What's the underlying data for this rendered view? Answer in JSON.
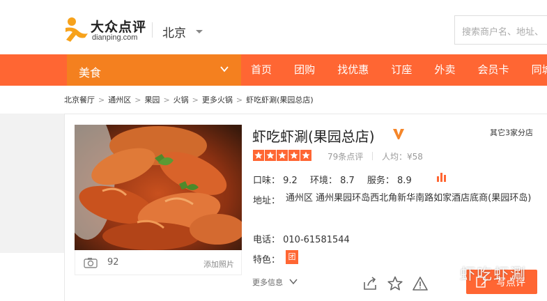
{
  "header": {
    "logo_cn": "大众点评",
    "logo_en": "dianping.com",
    "city": "北京",
    "search_placeholder": "搜索商户名、地址、"
  },
  "nav": {
    "category": "美食",
    "items": [
      "首页",
      "团购",
      "找优惠",
      "订座",
      "外卖",
      "会员卡",
      "同城"
    ]
  },
  "breadcrumb": [
    "北京餐厅",
    "通州区",
    "果园",
    "火锅",
    "更多火锅",
    "虾吃虾涮(果园总店)"
  ],
  "shop": {
    "name": "虾吃虾涮(果园总店)",
    "branches": "其它3家分店",
    "stars": 5,
    "review_count": "79条点评",
    "per_capita": "人均：¥58",
    "scores": {
      "taste": "口味： 9.2",
      "env": "环境： 8.7",
      "service": "服务： 8.9"
    },
    "address_label": "地址：",
    "address": "通州区 通州果园环岛西北角新华南路如家酒店底商(果园环岛)",
    "phone": "电话： 010-61581544",
    "features_label": "特色：",
    "tuan_badge": "团",
    "photo_count": "92",
    "add_photo": "添加照片",
    "more_info": "更多信息",
    "write_review": "写点评"
  },
  "watermark": "虾吃虾涮",
  "colors": {
    "brand_orange": "#ff6633",
    "nav_category": "#f4801f"
  }
}
